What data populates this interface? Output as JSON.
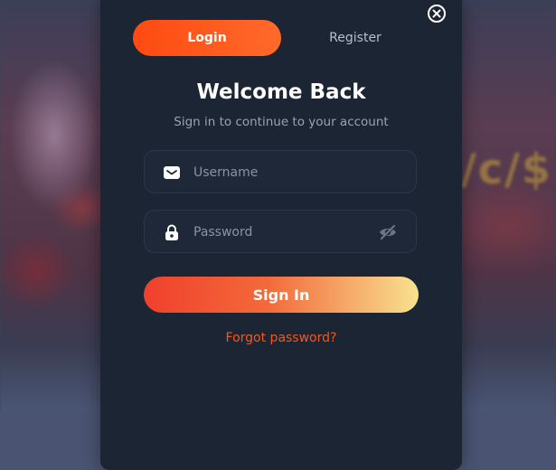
{
  "tabs": {
    "login_label": "Login",
    "register_label": "Register",
    "active": "login"
  },
  "form": {
    "title": "Welcome Back",
    "subtitle": "Sign in to continue to your account",
    "username_placeholder": "Username",
    "password_placeholder": "Password",
    "submit_label": "Sign In",
    "forgot_label": "Forgot password?"
  },
  "background": {
    "partial_text": "/c/$"
  },
  "icons": {
    "close": "close-icon",
    "username": "envelope-icon",
    "password": "lock-icon",
    "password_toggle": "eye-off-icon"
  },
  "colors": {
    "accent": "#ff4a12",
    "modal_bg": "#1c2534",
    "link": "#f2581c"
  }
}
